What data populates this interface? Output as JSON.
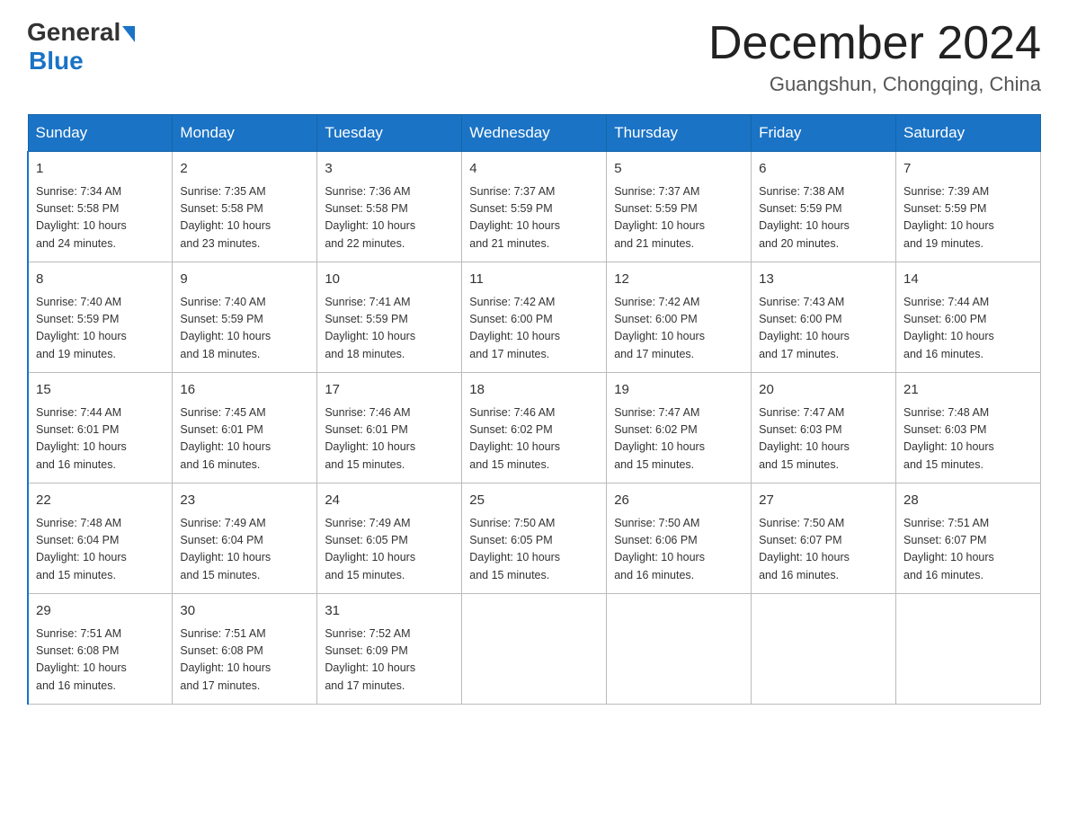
{
  "header": {
    "logo_general": "General",
    "logo_blue": "Blue",
    "month_title": "December 2024",
    "location": "Guangshun, Chongqing, China"
  },
  "days_of_week": [
    "Sunday",
    "Monday",
    "Tuesday",
    "Wednesday",
    "Thursday",
    "Friday",
    "Saturday"
  ],
  "weeks": [
    [
      {
        "day": "1",
        "sunrise": "7:34 AM",
        "sunset": "5:58 PM",
        "daylight": "10 hours and 24 minutes."
      },
      {
        "day": "2",
        "sunrise": "7:35 AM",
        "sunset": "5:58 PM",
        "daylight": "10 hours and 23 minutes."
      },
      {
        "day": "3",
        "sunrise": "7:36 AM",
        "sunset": "5:58 PM",
        "daylight": "10 hours and 22 minutes."
      },
      {
        "day": "4",
        "sunrise": "7:37 AM",
        "sunset": "5:59 PM",
        "daylight": "10 hours and 21 minutes."
      },
      {
        "day": "5",
        "sunrise": "7:37 AM",
        "sunset": "5:59 PM",
        "daylight": "10 hours and 21 minutes."
      },
      {
        "day": "6",
        "sunrise": "7:38 AM",
        "sunset": "5:59 PM",
        "daylight": "10 hours and 20 minutes."
      },
      {
        "day": "7",
        "sunrise": "7:39 AM",
        "sunset": "5:59 PM",
        "daylight": "10 hours and 19 minutes."
      }
    ],
    [
      {
        "day": "8",
        "sunrise": "7:40 AM",
        "sunset": "5:59 PM",
        "daylight": "10 hours and 19 minutes."
      },
      {
        "day": "9",
        "sunrise": "7:40 AM",
        "sunset": "5:59 PM",
        "daylight": "10 hours and 18 minutes."
      },
      {
        "day": "10",
        "sunrise": "7:41 AM",
        "sunset": "5:59 PM",
        "daylight": "10 hours and 18 minutes."
      },
      {
        "day": "11",
        "sunrise": "7:42 AM",
        "sunset": "6:00 PM",
        "daylight": "10 hours and 17 minutes."
      },
      {
        "day": "12",
        "sunrise": "7:42 AM",
        "sunset": "6:00 PM",
        "daylight": "10 hours and 17 minutes."
      },
      {
        "day": "13",
        "sunrise": "7:43 AM",
        "sunset": "6:00 PM",
        "daylight": "10 hours and 17 minutes."
      },
      {
        "day": "14",
        "sunrise": "7:44 AM",
        "sunset": "6:00 PM",
        "daylight": "10 hours and 16 minutes."
      }
    ],
    [
      {
        "day": "15",
        "sunrise": "7:44 AM",
        "sunset": "6:01 PM",
        "daylight": "10 hours and 16 minutes."
      },
      {
        "day": "16",
        "sunrise": "7:45 AM",
        "sunset": "6:01 PM",
        "daylight": "10 hours and 16 minutes."
      },
      {
        "day": "17",
        "sunrise": "7:46 AM",
        "sunset": "6:01 PM",
        "daylight": "10 hours and 15 minutes."
      },
      {
        "day": "18",
        "sunrise": "7:46 AM",
        "sunset": "6:02 PM",
        "daylight": "10 hours and 15 minutes."
      },
      {
        "day": "19",
        "sunrise": "7:47 AM",
        "sunset": "6:02 PM",
        "daylight": "10 hours and 15 minutes."
      },
      {
        "day": "20",
        "sunrise": "7:47 AM",
        "sunset": "6:03 PM",
        "daylight": "10 hours and 15 minutes."
      },
      {
        "day": "21",
        "sunrise": "7:48 AM",
        "sunset": "6:03 PM",
        "daylight": "10 hours and 15 minutes."
      }
    ],
    [
      {
        "day": "22",
        "sunrise": "7:48 AM",
        "sunset": "6:04 PM",
        "daylight": "10 hours and 15 minutes."
      },
      {
        "day": "23",
        "sunrise": "7:49 AM",
        "sunset": "6:04 PM",
        "daylight": "10 hours and 15 minutes."
      },
      {
        "day": "24",
        "sunrise": "7:49 AM",
        "sunset": "6:05 PM",
        "daylight": "10 hours and 15 minutes."
      },
      {
        "day": "25",
        "sunrise": "7:50 AM",
        "sunset": "6:05 PM",
        "daylight": "10 hours and 15 minutes."
      },
      {
        "day": "26",
        "sunrise": "7:50 AM",
        "sunset": "6:06 PM",
        "daylight": "10 hours and 16 minutes."
      },
      {
        "day": "27",
        "sunrise": "7:50 AM",
        "sunset": "6:07 PM",
        "daylight": "10 hours and 16 minutes."
      },
      {
        "day": "28",
        "sunrise": "7:51 AM",
        "sunset": "6:07 PM",
        "daylight": "10 hours and 16 minutes."
      }
    ],
    [
      {
        "day": "29",
        "sunrise": "7:51 AM",
        "sunset": "6:08 PM",
        "daylight": "10 hours and 16 minutes."
      },
      {
        "day": "30",
        "sunrise": "7:51 AM",
        "sunset": "6:08 PM",
        "daylight": "10 hours and 17 minutes."
      },
      {
        "day": "31",
        "sunrise": "7:52 AM",
        "sunset": "6:09 PM",
        "daylight": "10 hours and 17 minutes."
      },
      null,
      null,
      null,
      null
    ]
  ],
  "labels": {
    "sunrise": "Sunrise:",
    "sunset": "Sunset:",
    "daylight": "Daylight:"
  }
}
